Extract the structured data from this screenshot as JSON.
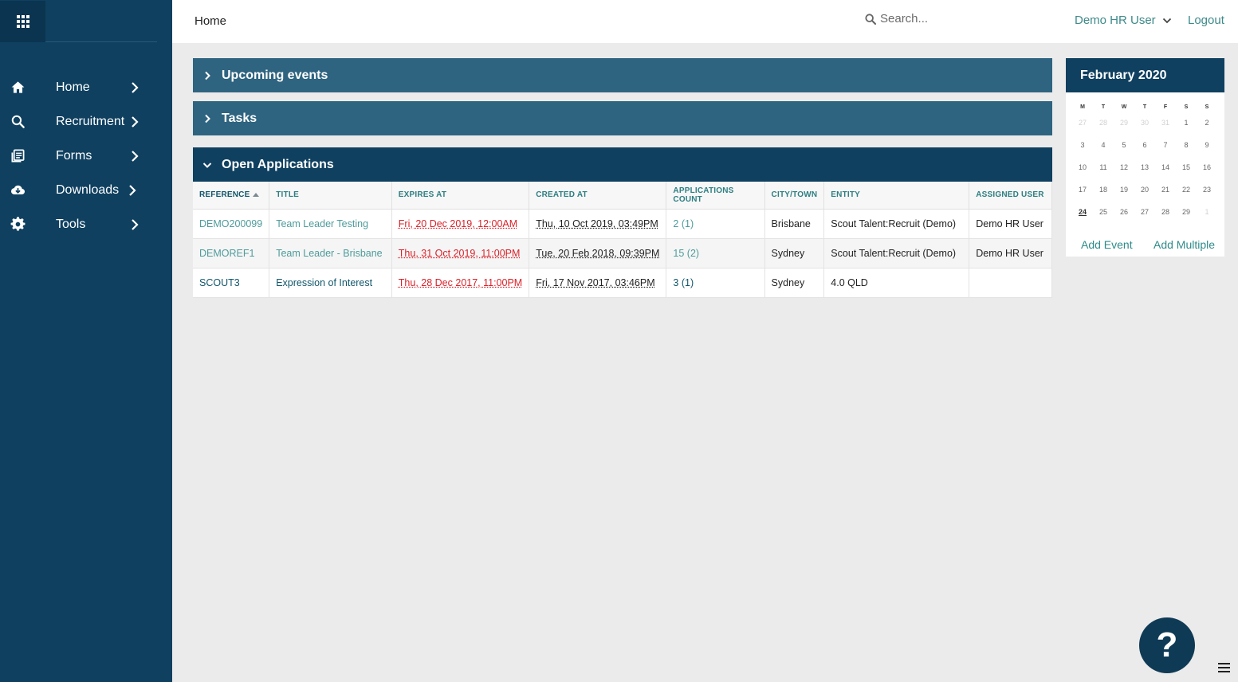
{
  "topbar": {
    "breadcrumb": "Home",
    "search_placeholder": "Search...",
    "user_name": "Demo HR User",
    "logout_label": "Logout"
  },
  "sidebar": {
    "items": [
      {
        "label": "Home",
        "icon": "home-icon"
      },
      {
        "label": "Recruitment",
        "icon": "search-icon"
      },
      {
        "label": "Forms",
        "icon": "forms-icon"
      },
      {
        "label": "Downloads",
        "icon": "cloud-download-icon"
      },
      {
        "label": "Tools",
        "icon": "gear-icon"
      }
    ]
  },
  "panels": {
    "upcoming_events": "Upcoming events",
    "tasks": "Tasks",
    "open_applications": "Open Applications"
  },
  "table": {
    "headers": [
      "REFERENCE",
      "TITLE",
      "EXPIRES AT",
      "CREATED AT",
      "APPLICATIONS COUNT",
      "CITY/TOWN",
      "ENTITY",
      "ASSIGNED USER"
    ],
    "rows": [
      {
        "reference": "DEMO200099",
        "title": "Team Leader Testing",
        "expires_at": "Fri, 20 Dec 2019, 12:00AM",
        "created_at": "Thu, 10 Oct 2019, 03:49PM",
        "applications_count": "2 (1)",
        "city": "Brisbane",
        "entity": "Scout Talent:Recruit (Demo)",
        "assigned_user": "Demo HR User"
      },
      {
        "reference": "DEMOREF1",
        "title": "Team Leader - Brisbane",
        "expires_at": "Thu, 31 Oct 2019, 11:00PM",
        "created_at": "Tue, 20 Feb 2018, 09:39PM",
        "applications_count": "15 (2)",
        "city": "Sydney",
        "entity": "Scout Talent:Recruit (Demo)",
        "assigned_user": "Demo HR User"
      },
      {
        "reference": "SCOUT3",
        "title": "Expression of Interest",
        "expires_at": "Thu, 28 Dec 2017, 11:00PM",
        "created_at": "Fri, 17 Nov 2017, 03:46PM",
        "applications_count": "3 (1)",
        "city": "Sydney",
        "entity": "4.0 QLD",
        "assigned_user": ""
      }
    ]
  },
  "calendar": {
    "title": "February 2020",
    "weekdays": [
      "M",
      "T",
      "W",
      "T",
      "F",
      "S",
      "S"
    ],
    "days": [
      "27",
      "28",
      "29",
      "30",
      "31",
      "1",
      "2",
      "3",
      "4",
      "5",
      "6",
      "7",
      "8",
      "9",
      "10",
      "11",
      "12",
      "13",
      "14",
      "15",
      "16",
      "17",
      "18",
      "19",
      "20",
      "21",
      "22",
      "23",
      "24",
      "25",
      "26",
      "27",
      "28",
      "29",
      "1"
    ],
    "add_event_label": "Add Event",
    "add_multiple_label": "Add Multiple"
  },
  "help": {
    "label": "?"
  },
  "colors": {
    "sidebar": "#0f4060",
    "panel_collapsed": "#2e6480",
    "accent_teal": "#3e8a8a",
    "expired_red": "#d9222a"
  }
}
